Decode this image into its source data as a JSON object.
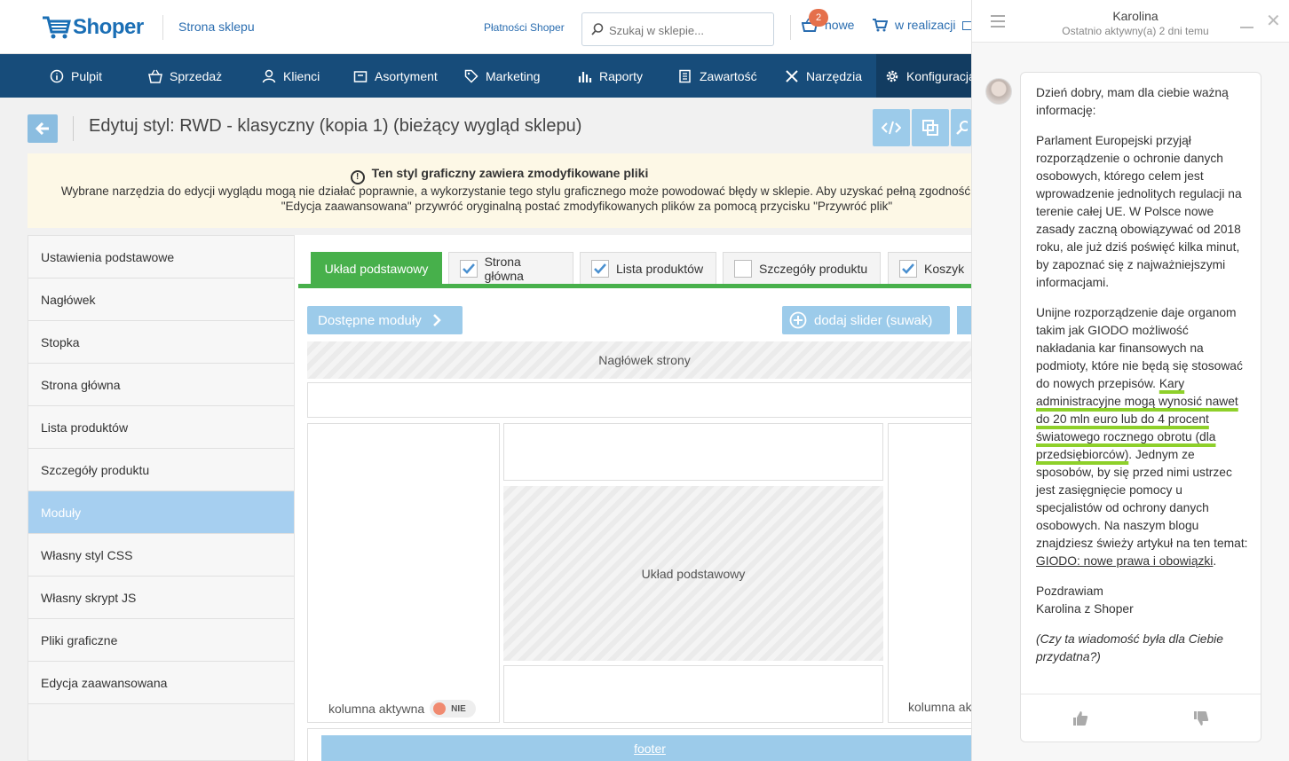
{
  "header": {
    "logo_text": "Shoper",
    "store_link": "Strona sklepu",
    "payments_link": "Płatności Shoper",
    "search_placeholder": "Szukaj w sklepie...",
    "new_count": "2",
    "new_label": "nowe",
    "in_progress_label": "w realizacji"
  },
  "nav": {
    "items": [
      {
        "label": "Pulpit",
        "icon": "info-icon"
      },
      {
        "label": "Sprzedaż",
        "icon": "basket-icon"
      },
      {
        "label": "Klienci",
        "icon": "user-icon"
      },
      {
        "label": "Asortyment",
        "icon": "box-icon"
      },
      {
        "label": "Marketing",
        "icon": "tag-icon"
      },
      {
        "label": "Raporty",
        "icon": "bar-chart-icon"
      },
      {
        "label": "Zawartość",
        "icon": "document-icon"
      },
      {
        "label": "Narzędzia",
        "icon": "tools-icon"
      },
      {
        "label": "Konfiguracja",
        "icon": "gear-icon"
      }
    ],
    "active": "Konfiguracja"
  },
  "page": {
    "title": "Edytuj styl: RWD - klasyczny (kopia 1) (bieżący wygląd sklepu)"
  },
  "warning": {
    "title": "Ten styl graficzny zawiera zmodyfikowane pliki",
    "line1": "Wybrane narzędzia do edycji wyglądu mogą nie działać poprawnie, a wykorzystanie tego stylu graficznego może powodować błędy w sklepie. Aby uzyskać pełną zgodność",
    "line2": "\"Edycja zaawansowana\" przywróć oryginalną postać zmodyfikowanych plików za pomocą przycisku \"Przywróć plik\""
  },
  "sidebar": {
    "items": [
      {
        "label": "Ustawienia podstawowe"
      },
      {
        "label": "Nagłówek"
      },
      {
        "label": "Stopka"
      },
      {
        "label": "Strona główna"
      },
      {
        "label": "Lista produktów"
      },
      {
        "label": "Szczegóły produktu"
      },
      {
        "label": "Moduły"
      },
      {
        "label": "Własny styl CSS"
      },
      {
        "label": "Własny skrypt JS"
      },
      {
        "label": "Pliki graficzne"
      },
      {
        "label": "Edycja zaawansowana"
      }
    ],
    "active": "Moduły"
  },
  "tabs": [
    {
      "label": "Układ podstawowy",
      "checked": null
    },
    {
      "label": "Strona główna",
      "checked": true
    },
    {
      "label": "Lista produktów",
      "checked": true
    },
    {
      "label": "Szczegóły produktu",
      "checked": false
    },
    {
      "label": "Koszyk",
      "checked": true
    }
  ],
  "layout": {
    "modules_button": "Dostępne moduły",
    "slider_button": "dodaj slider (suwak)",
    "header_area": "Nagłówek strony",
    "center_area": "Układ podstawowy",
    "column_active_label": "kolumna aktywna",
    "column_active_right": "kolumna ak",
    "toggle_value": "NIE",
    "footer_link": "footer"
  },
  "chat": {
    "agent_name": "Karolina",
    "agent_status": "Ostatnio aktywny(a) 2 dni temu",
    "greeting": "Dzień dobry, mam dla ciebie ważną informację:",
    "p1": "Parlament Europejski przyjął rozporządzenie o ochronie danych osobowych, którego celem jest wprowadzenie jednolitych regulacji na terenie całej UE. W Polsce nowe zasady zaczną obowiązywać od 2018 roku, ale już dziś poświęć kilka minut, by zapoznać się z najważniejszymi informacjami.",
    "p2_start": "Unijne rozporządzenie daje organom takim jak GIODO możliwość nakładania kar finansowych na podmioty, które nie będą się stosować do nowych przepisów. ",
    "p2_highlight": "Kary administracyjne mogą wynosić nawet do 20 mln euro lub do 4 procent światowego rocznego obrotu (dla przedsiębiorców)",
    "p2_end": ". Jednym ze sposobów, by się przed nimi ustrzec jest zasięgnięcie pomocy u specjalistów od ochrony danych osobowych. Na naszym blogu znajdziesz świeży artykuł na ten temat: ",
    "p2_link": "GIODO: nowe prawa i obowiązki",
    "p2_dot": ".",
    "signoff1": "Pozdrawiam",
    "signoff2": "Karolina z Shoper",
    "question": "(Czy ta wiadomość była dla Ciebie przydatna?)"
  },
  "colors": {
    "nav_bg": "#174c7a",
    "accent_blue": "#9ccbea",
    "tab_green": "#47b04b",
    "badge": "#e5704b",
    "highlight": "#8ed02a"
  }
}
